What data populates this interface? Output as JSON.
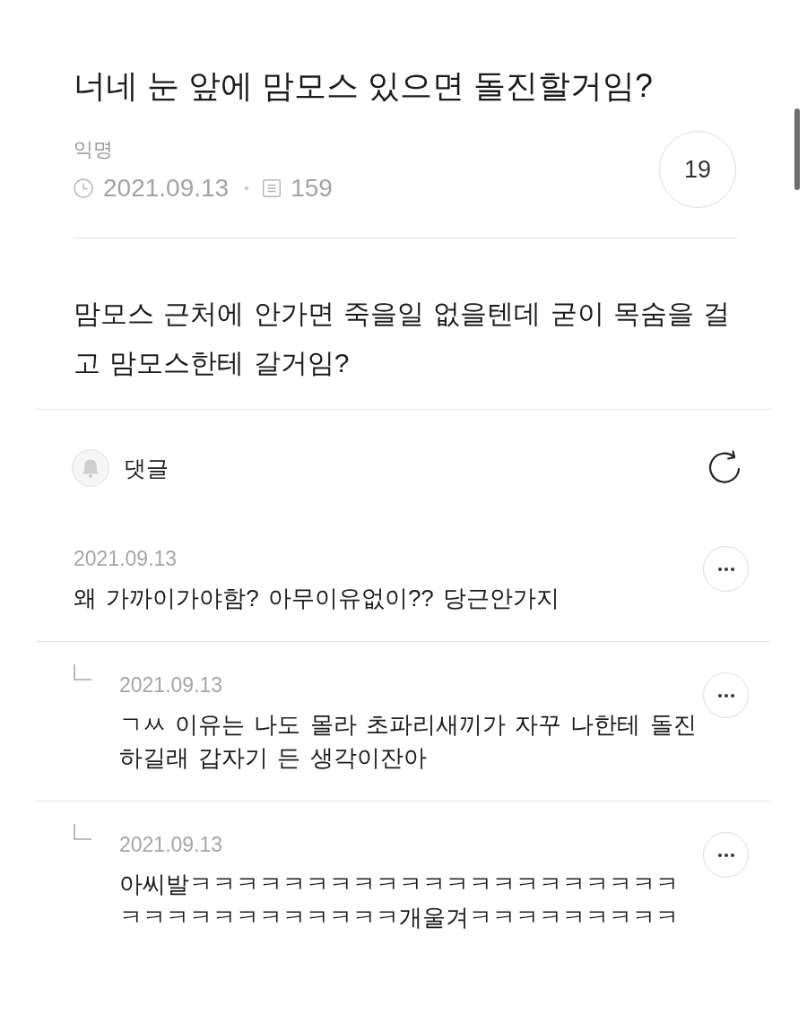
{
  "post": {
    "title": "너네 눈 앞에 맘모스 있으면 돌진할거임?",
    "author": "익명",
    "date": "2021.09.13",
    "views": "159",
    "comment_count": "19",
    "body": "맘모스 근처에 안가면 죽을일 없을텐데 굳이 목숨을 걸고 맘모스한테 갈거임?"
  },
  "comments_header": {
    "label": "댓글"
  },
  "comments": [
    {
      "kind": "comment",
      "date": "2021.09.13",
      "text": "왜 가까이가야함? 아무이유없이?? 당근안가지"
    },
    {
      "kind": "reply",
      "date": "2021.09.13",
      "text": "ㄱㅆ 이유는 나도 몰라 초파리새끼가 자꾸 나한테 돌진하길래 갑자기 든 생각이잔아"
    },
    {
      "kind": "reply",
      "date": "2021.09.13",
      "text": "아씨발ㅋㅋㅋㅋㅋㅋㅋㅋㅋㅋㅋㅋㅋㅋㅋㅋㅋㅋㅋㅋㅋㅋㅋㅋㅋㅋㅋㅋㅋㅋㅋㅋㅋ개울겨ㅋㅋㅋㅋㅋㅋㅋㅋㅋ"
    }
  ]
}
